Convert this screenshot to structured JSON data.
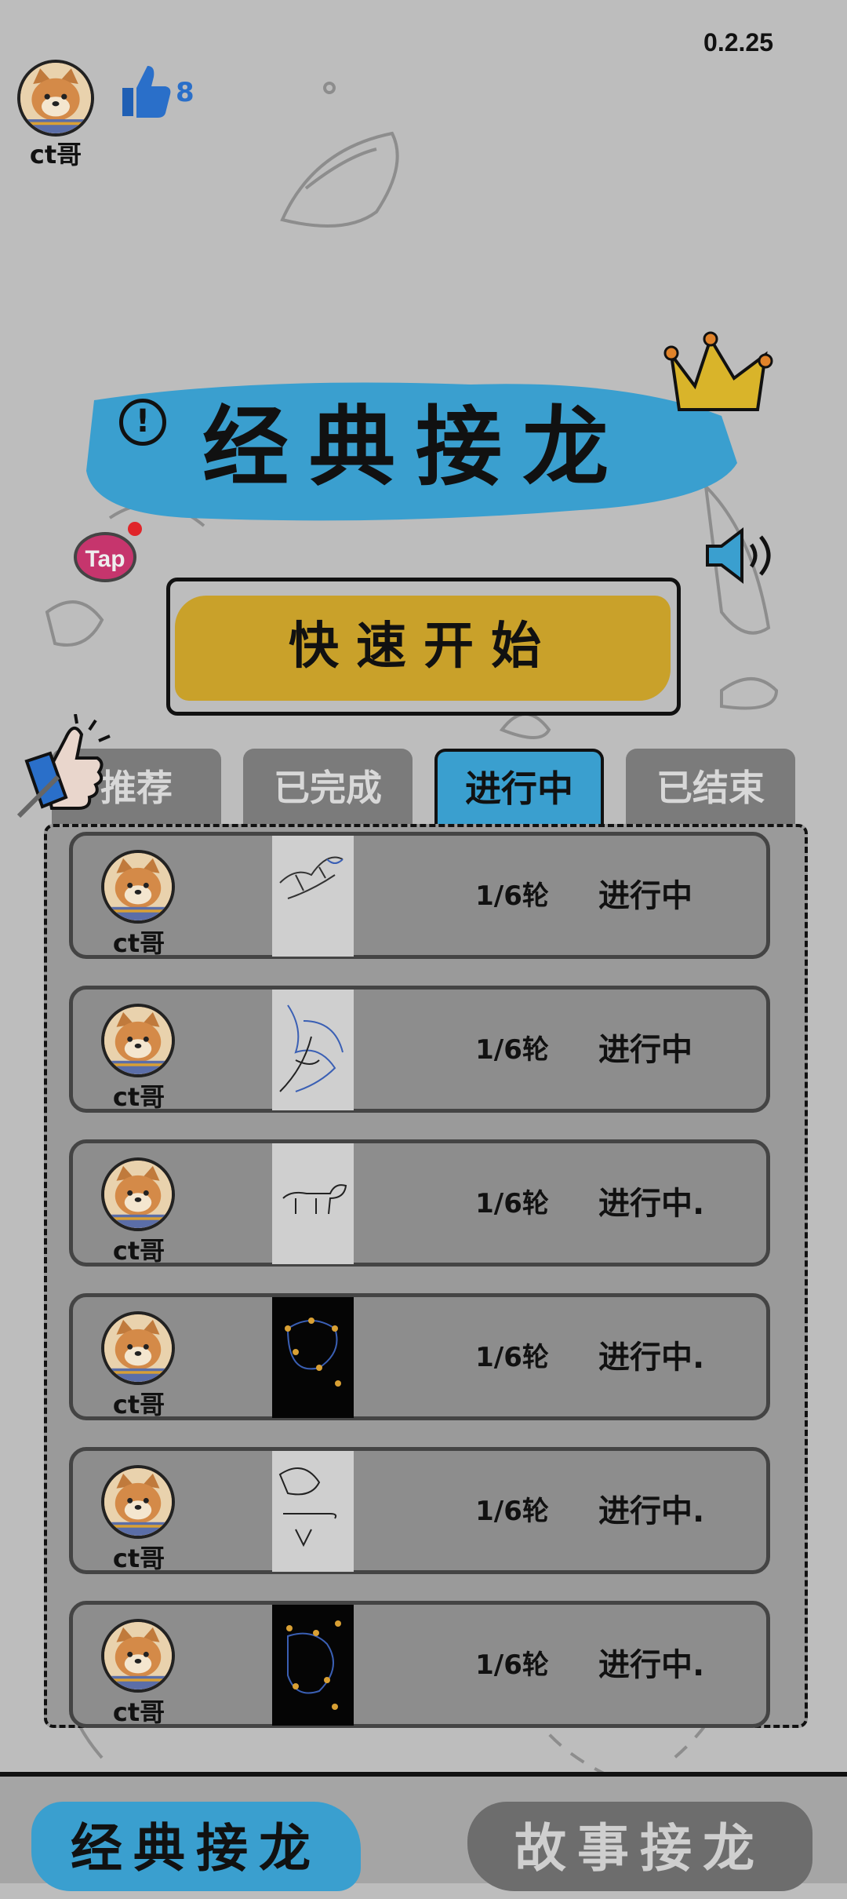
{
  "version": "0.2.25",
  "user": {
    "name": "ct哥",
    "likes": "8"
  },
  "title": "经典接龙",
  "quick_start": "快速开始",
  "info_icon": "!",
  "tap_badge": "Tap",
  "tabs": [
    {
      "label": "推荐",
      "active": false
    },
    {
      "label": "已完成",
      "active": false
    },
    {
      "label": "进行中",
      "active": true
    },
    {
      "label": "已结束",
      "active": false
    }
  ],
  "rows": [
    {
      "name": "ct哥",
      "round": "1/6轮",
      "status": "进行中",
      "thumb": "light"
    },
    {
      "name": "ct哥",
      "round": "1/6轮",
      "status": "进行中",
      "thumb": "light"
    },
    {
      "name": "ct哥",
      "round": "1/6轮",
      "status": "进行中.",
      "thumb": "light"
    },
    {
      "name": "ct哥",
      "round": "1/6轮",
      "status": "进行中.",
      "thumb": "dark"
    },
    {
      "name": "ct哥",
      "round": "1/6轮",
      "status": "进行中.",
      "thumb": "light"
    },
    {
      "name": "ct哥",
      "round": "1/6轮",
      "status": "进行中.",
      "thumb": "dark"
    }
  ],
  "bottom_nav": [
    {
      "label": "经典接龙",
      "active": true
    },
    {
      "label": "故事接龙",
      "active": false
    }
  ],
  "colors": {
    "accent": "#3a9fcf",
    "gold": "#c9a12a",
    "like": "#2a6fc9"
  },
  "icons": [
    "avatar-dog-icon",
    "thumbs-up-icon",
    "crown-icon",
    "info-icon",
    "tap-badge-icon",
    "speaker-icon",
    "pointing-hand-icon"
  ]
}
